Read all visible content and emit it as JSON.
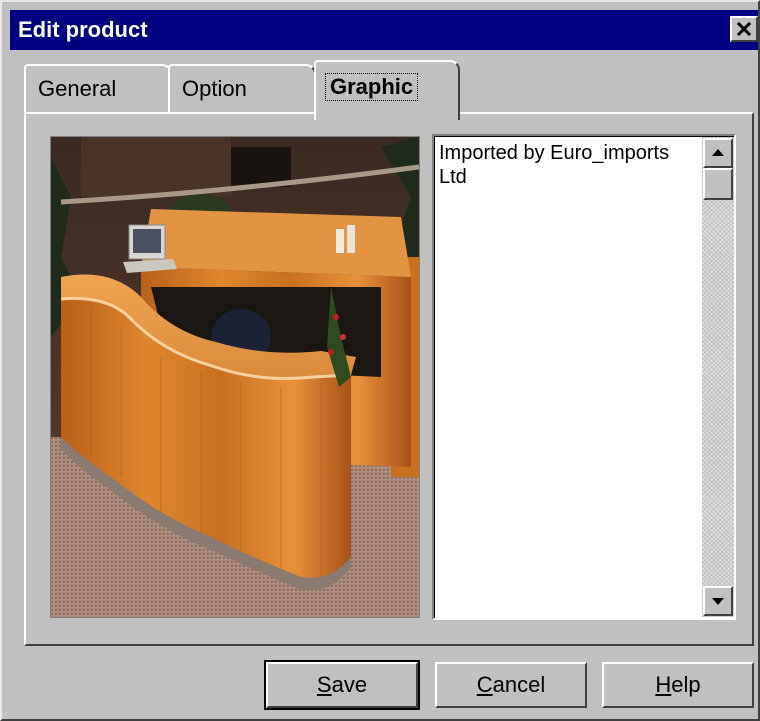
{
  "window": {
    "title": "Edit product",
    "close_glyph": "✕"
  },
  "tabs": [
    {
      "label": "General",
      "active": false
    },
    {
      "label": "Option",
      "active": false
    },
    {
      "label": "Graphic",
      "active": true
    }
  ],
  "graphic": {
    "image_icon": "product-photo-reception-desk",
    "description": "Imported by Euro_imports Ltd"
  },
  "buttons": {
    "save": {
      "mnemonic": "S",
      "rest": "ave"
    },
    "cancel": {
      "mnemonic": "C",
      "rest": "ancel"
    },
    "help": {
      "mnemonic": "H",
      "rest": "elp"
    }
  },
  "colors": {
    "titlebar": "#000080",
    "face": "#c0c0c0"
  }
}
